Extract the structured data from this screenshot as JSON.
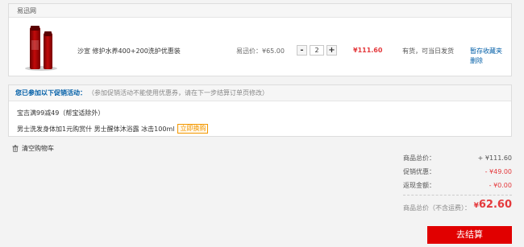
{
  "cart": {
    "header": "易迅网",
    "item": {
      "name": "沙宣 修护水养400+200洗护优惠装",
      "price": "易迅价：¥65.00",
      "qty_minus": "-",
      "qty": "2",
      "qty_plus": "+",
      "subtotal": "¥111.60",
      "stock": "有货，可当日发货",
      "op_favorite": "暂存收藏夹",
      "op_delete": "删除"
    }
  },
  "promo": {
    "title": "您已参加以下促销活动：",
    "note": "（参加促销活动不能使用优惠券，请在下一步结算订单页修改）",
    "line1": "宝吉满99减49（帮宝适除外）",
    "line2": "男士洗发身体加1元购赏什 男士醒体沐浴露 冰击100ml",
    "buy_button": "立即换购"
  },
  "clear_cart": "清空购物车",
  "summary": {
    "items_total_label": "商品总价：",
    "items_total_value": "+ ¥111.60",
    "promo_label": "促销优惠：",
    "promo_value": "- ¥49.00",
    "cashback_label": "返现金额：",
    "cashback_value": "- ¥0.00",
    "grand_label": "商品总价（不含运费）：",
    "grand_value": "62.60",
    "grand_prefix": "¥"
  },
  "checkout_button": "去结算"
}
